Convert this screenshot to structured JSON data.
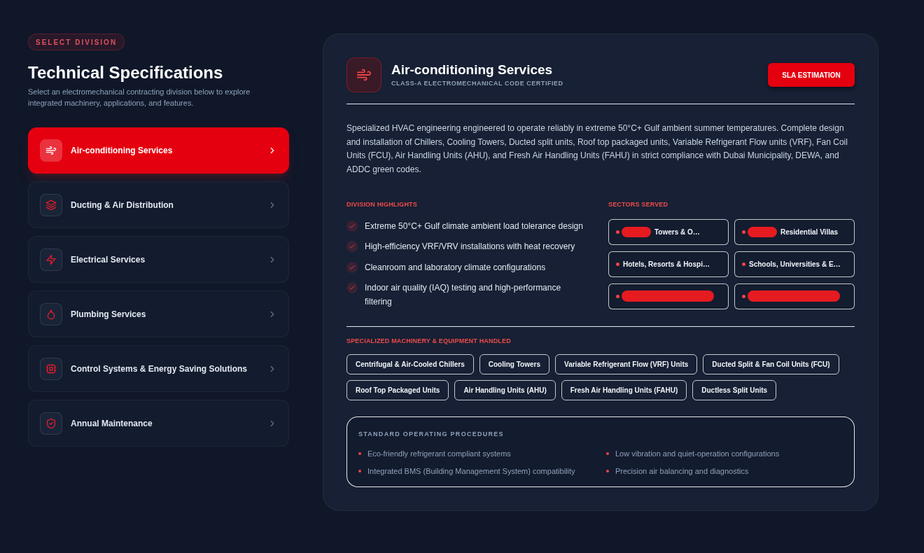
{
  "sidebar": {
    "badge": "SELECT DIVISION",
    "title": "Technical Specifications",
    "subtitle": "Select an electromechanical contracting division below to explore integrated machinery, applications, and features.",
    "items": [
      {
        "label": "Air-conditioning Services",
        "selected": true
      },
      {
        "label": "Ducting & Air Distribution",
        "selected": false
      },
      {
        "label": "Electrical Services",
        "selected": false
      },
      {
        "label": "Plumbing Services",
        "selected": false
      },
      {
        "label": "Control Systems & Energy Saving Solutions",
        "selected": false
      },
      {
        "label": "Annual Maintenance",
        "selected": false
      }
    ]
  },
  "detail": {
    "title": "Air-conditioning Services",
    "subtitle": "CLASS-A ELECTROMECHANICAL CODE CERTIFIED",
    "button": "SLA ESTIMATION",
    "description": "Specialized HVAC engineering engineered to operate reliably in extreme 50°C+ Gulf ambient summer temperatures. Complete design and installation of Chillers, Cooling Towers, Ducted split units, Roof top packaged units, Variable Refrigerant Flow units (VRF), Fan Coil Units (FCU), Air Handling Units (AHU), and Fresh Air Handling Units (FAHU) in strict compliance with Dubai Municipality, DEWA, and ADDC green codes.",
    "highlights": {
      "heading": "DIVISION HIGHLIGHTS",
      "items": [
        "Extreme 50°C+ Gulf climate ambient load tolerance design",
        "High-efficiency VRF/VRV installations with heat recovery",
        "Cleanroom and laboratory climate configurations",
        "Indoor air quality (IAQ) testing and high-performance filtering"
      ]
    },
    "sectors": {
      "heading": "SECTORS SERVED",
      "items": [
        {
          "text": "Towers & O…",
          "redacted": true
        },
        {
          "text": "Residential Villas",
          "redacted": true
        },
        {
          "text": "Hotels, Resorts & Hospi…",
          "redacted": false
        },
        {
          "text": "Schools, Universities & E…",
          "redacted": false
        },
        {
          "redacted": true
        },
        {
          "redacted": true
        }
      ]
    },
    "machinery": {
      "heading": "SPECIALIZED MACHINERY & EQUIPMENT HANDLED",
      "items": [
        "Centrifugal & Air-Cooled Chillers",
        "Cooling Towers",
        "Variable Refrigerant Flow (VRF) Units",
        "Ducted Split & Fan Coil Units (FCU)",
        "Roof Top Packaged Units",
        "Air Handling Units (AHU)",
        "Fresh Air Handling Units (FAHU)",
        "Ductless Split Units"
      ]
    },
    "procedures": {
      "heading": "STANDARD OPERATING PROCEDURES",
      "items": [
        "Eco-friendly refrigerant compliant systems",
        "Low vibration and quiet-operation configurations",
        "Integrated BMS (Building Management System) compatibility",
        "Precision air balancing and diagnostics"
      ]
    }
  }
}
